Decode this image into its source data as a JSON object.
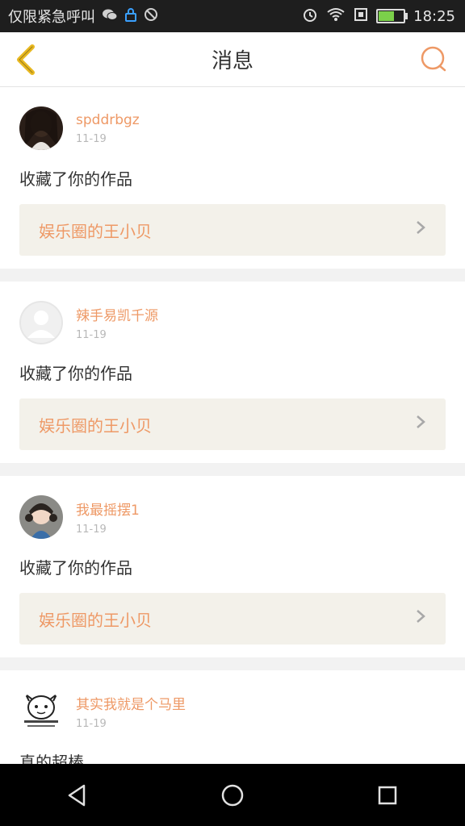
{
  "status_bar": {
    "text": "仅限紧急呼叫",
    "icons": [
      "wechat-icon",
      "lock-icon",
      "blocked-icon"
    ],
    "time": "18:25",
    "battery_level": 0.6
  },
  "nav": {
    "title": "消息"
  },
  "messages": [
    {
      "name": "spddrbgz",
      "date": "11-19",
      "action": "收藏了你的作品",
      "work": "娱乐圈的王小贝"
    },
    {
      "name": "辣手易凯千源",
      "date": "11-19",
      "action": "收藏了你的作品",
      "work": "娱乐圈的王小贝"
    },
    {
      "name": "我最摇摆1",
      "date": "11-19",
      "action": "收藏了你的作品",
      "work": "娱乐圈的王小贝"
    },
    {
      "name": "其实我就是个马里",
      "date": "11-19",
      "action": "真的超棒"
    }
  ],
  "colors": {
    "accent": "#ee9966",
    "status_bg": "#1e1e1e",
    "navsys_bg": "#000000"
  }
}
